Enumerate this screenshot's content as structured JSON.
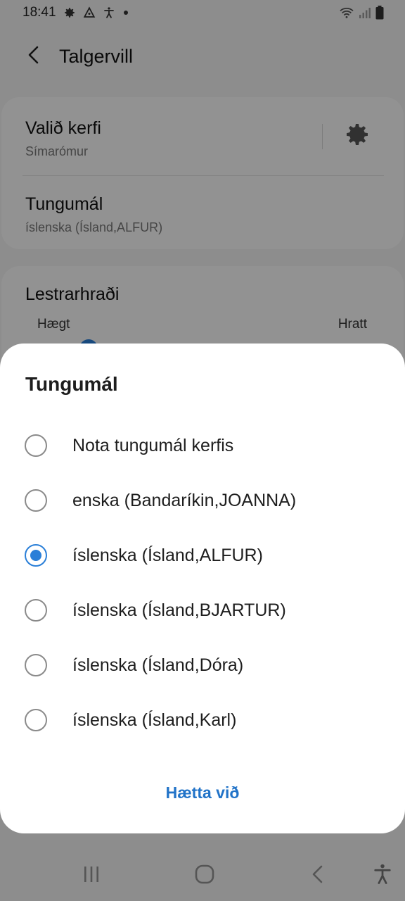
{
  "status_bar": {
    "time": "18:41",
    "icons": [
      "gear-icon",
      "triangle-app-icon",
      "accessibility-icon",
      "dot-icon",
      "wifi-icon",
      "signal-icon",
      "battery-icon"
    ]
  },
  "app_bar": {
    "title": "Talgervill",
    "back_icon": "back-chevron-icon"
  },
  "settings": {
    "engine": {
      "title": "Valið kerfi",
      "value": "Símarómur",
      "icon": "gear-icon"
    },
    "language": {
      "title": "Tungumál",
      "value": "íslenska (Ísland,ALFUR)"
    },
    "speech_rate": {
      "title": "Lestrarhraði",
      "min_label": "Hægt",
      "max_label": "Hratt"
    }
  },
  "dialog": {
    "title": "Tungumál",
    "options": [
      {
        "label": "Nota tungumál kerfis",
        "selected": false
      },
      {
        "label": "enska (Bandaríkin,JOANNA)",
        "selected": false
      },
      {
        "label": "íslenska (Ísland,ALFUR)",
        "selected": true
      },
      {
        "label": "íslenska (Ísland,BJARTUR)",
        "selected": false
      },
      {
        "label": "íslenska (Ísland,Dóra)",
        "selected": false
      },
      {
        "label": "íslenska (Ísland,Karl)",
        "selected": false
      }
    ],
    "cancel_label": "Hætta við"
  },
  "nav_bar": {
    "icons": [
      "recent-apps-icon",
      "home-icon",
      "back-icon",
      "accessibility-icon"
    ]
  },
  "colors": {
    "accent": "#2a7fd8",
    "link": "#2173c8"
  }
}
